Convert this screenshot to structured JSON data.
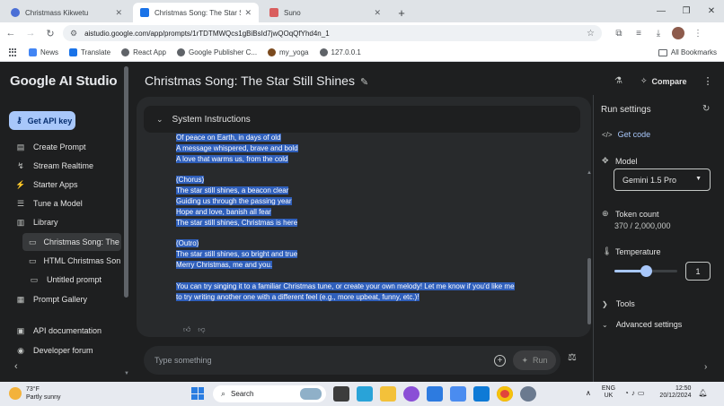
{
  "browser": {
    "tabs": [
      {
        "title": "Christmass Kikwetu",
        "close": "✕",
        "favicon_color": "#4b6fd6"
      },
      {
        "title": "Christmas Song: The Star Still Sh",
        "close": "✕",
        "favicon_color": "#1a73e8"
      },
      {
        "title": "Suno",
        "close": "✕",
        "favicon_color": "#d95e5e"
      }
    ],
    "new_tab": "+",
    "url": "aistudio.google.com/app/prompts/1rTDTMWQcs1gBiBsId7jwQOqQfYhd4n_1",
    "bookmarks": [
      "News",
      "Translate",
      "React App",
      "Google Publisher C...",
      "my_yoga",
      "127.0.0.1"
    ],
    "all_bookmarks": "All Bookmarks"
  },
  "sidebar": {
    "brand": "Google AI Studio",
    "api_key_label": "Get API key",
    "nav": [
      {
        "label": "Create Prompt",
        "icon": "▤"
      },
      {
        "label": "Stream Realtime",
        "icon": "↯"
      },
      {
        "label": "Starter Apps",
        "icon": "⚡"
      },
      {
        "label": "Tune a Model",
        "icon": "☰"
      },
      {
        "label": "Library",
        "icon": "▥"
      }
    ],
    "library": [
      {
        "label": "Christmas Song: The ..."
      },
      {
        "label": "HTML Christmas Son..."
      },
      {
        "label": "Untitled prompt"
      }
    ],
    "bottom": [
      {
        "label": "Prompt Gallery",
        "icon": "▦"
      },
      {
        "label": "API documentation",
        "icon": "▣"
      },
      {
        "label": "Developer forum",
        "icon": "◉"
      }
    ],
    "collapse": "‹"
  },
  "main": {
    "title": "Christmas Song: The Star Still Shines",
    "system_instructions": "System Instructions",
    "lyrics": [
      "Of peace on Earth, in days of old",
      "A message whispered, brave and bold",
      "A love that warms us, from the cold",
      "",
      "(Chorus)",
      "The star still shines, a beacon clear",
      "Guiding us through the passing year",
      "Hope and love, banish all fear",
      "The star still shines, Christmas is here",
      "",
      "(Outro)",
      "The star still shines, so bright and true",
      "Merry Christmas, me and you.",
      "",
      "You can try singing it to a familiar Christmas tune, or create your own melody! Let me know if you'd like me",
      "to try writing another one with a different feel (e.g., more upbeat, funny, etc.)!"
    ],
    "input_placeholder": "Type something",
    "run_label": "Run"
  },
  "settings": {
    "compare_label": "Compare",
    "title": "Run settings",
    "get_code": "Get code",
    "model_label": "Model",
    "model_value": "Gemini 1.5 Pro",
    "token_label": "Token count",
    "token_value": "370 / 2,000,000",
    "temperature_label": "Temperature",
    "temperature_value": "1",
    "temperature_fraction": 0.5,
    "tools_label": "Tools",
    "advanced_label": "Advanced settings"
  },
  "taskbar": {
    "temp": "73°F",
    "weather": "Partly sunny",
    "search": "Search",
    "lang_top": "ENG",
    "lang_bottom": "UK",
    "time": "12:50",
    "date": "20/12/2024"
  }
}
